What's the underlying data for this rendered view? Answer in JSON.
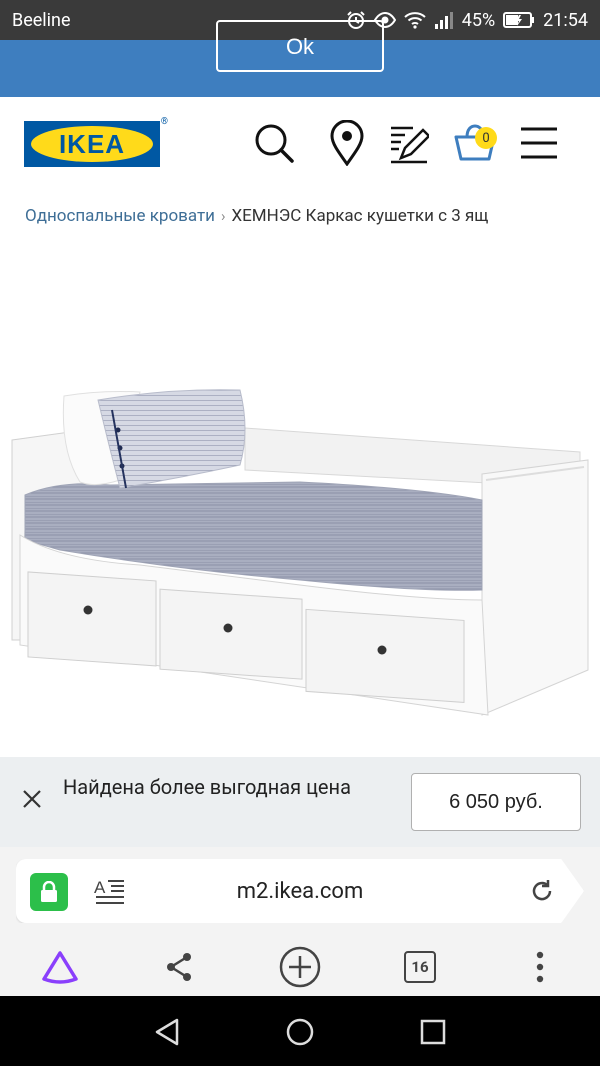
{
  "status_bar": {
    "carrier": "Beeline",
    "battery": "45%",
    "time": "21:54"
  },
  "banner": {
    "ok_label": "Ok"
  },
  "header": {
    "logo_text": "IKEA",
    "logo_reg": "®",
    "cart_count": "0"
  },
  "breadcrumb": {
    "parent": "Односпальные кровати",
    "separator": "›",
    "current": "ХЕМНЭС Каркас кушетки с 3 ящ"
  },
  "price_notice": {
    "message": "Найдена более выгодная цена",
    "price": "6 050 руб."
  },
  "browser": {
    "url": "m2.ikea.com",
    "tabs_count": "16"
  },
  "colors": {
    "banner_blue": "#3e7ebf",
    "ikea_blue": "#0058a3",
    "ikea_yellow": "#ffda1a",
    "lock_green": "#2cbf4a",
    "alice_purple": "#8a3ffc"
  }
}
